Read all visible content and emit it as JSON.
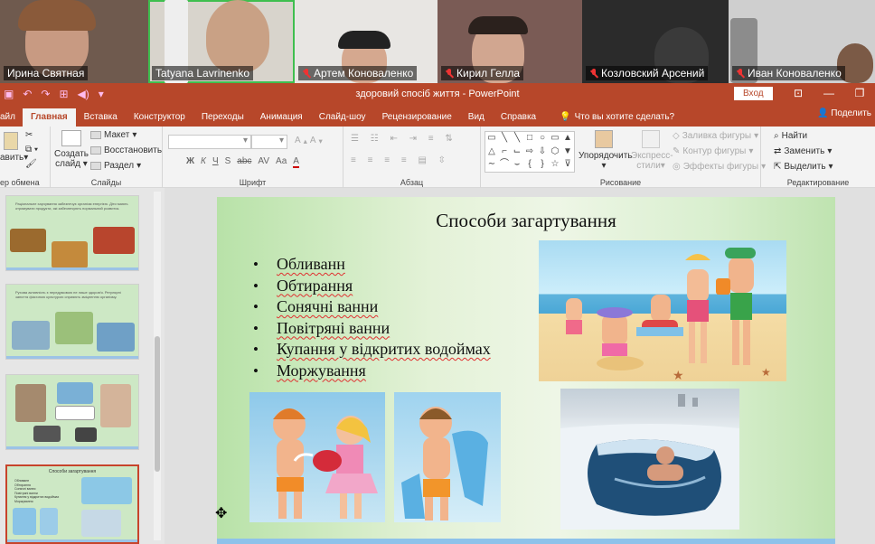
{
  "video": {
    "participants": [
      {
        "name": "Ирина Святная",
        "muted": false
      },
      {
        "name": "Tatyana Lavrinenko",
        "muted": false,
        "active": true
      },
      {
        "name": "Артем Коноваленко",
        "muted": true
      },
      {
        "name": "Кирил Гелла",
        "muted": true
      },
      {
        "name": "Козловский Арсений",
        "muted": true
      },
      {
        "name": "Иван Коноваленко",
        "muted": true
      }
    ]
  },
  "titlebar": {
    "title": "здоровий спосіб життя - PowerPoint",
    "login": "Вход"
  },
  "tabs": [
    "айл",
    "Главная",
    "Вставка",
    "Конструктор",
    "Переходы",
    "Анимация",
    "Слайд-шоу",
    "Рецензирование",
    "Вид",
    "Справка"
  ],
  "tellme": "Что вы хотите сделать?",
  "share": "Поделить",
  "ribbon": {
    "clipboard": {
      "paste": "авить",
      "label": "ер обмена"
    },
    "slides": {
      "new_slide_1": "Создать",
      "new_slide_2": "слайд",
      "layout": "Макет",
      "reset": "Восстановить",
      "section": "Раздел",
      "label": "Слайды"
    },
    "font": {
      "label": "Шрифт",
      "bold": "Ж",
      "italic": "К",
      "underline": "Ч",
      "strike": "S",
      "abc": "abc",
      "spacing": "AV",
      "case": "Aa",
      "color": "A"
    },
    "paragraph": {
      "label": "Абзац"
    },
    "drawing": {
      "arrange": "Упорядочить",
      "styles_1": "Экспресс-",
      "styles_2": "стили",
      "fill": "Заливка фигуры",
      "outline": "Контур фигуры",
      "effects": "Эффекты фигуры",
      "label": "Рисование"
    },
    "editing": {
      "find": "Найти",
      "replace": "Заменить",
      "select": "Выделить",
      "label": "Редактирование"
    }
  },
  "thumbnails": [
    {
      "text": "Раціональне харчування забезпечує організм енергією. Діти мають отримувати продукти, які забезпечують нормальний розвиток."
    },
    {
      "text": "Рухова активність є передумовою не лише здоров'я. Регулярні заняття фізичною культурою сприяють зміцненню організму."
    },
    {
      "text": ""
    },
    {
      "text": "Способи загартування",
      "selected": true
    }
  ],
  "slide": {
    "title": "Способи загартування",
    "bullets": [
      "Обливанн",
      "Обтирання",
      "Сонячні ванни",
      "Повітряні ванни",
      "Купання у відкритих водоймах",
      "Моржування"
    ]
  },
  "colors": {
    "ppt_red": "#b7472a",
    "active_tile": "#3fbf4f",
    "muted_icon": "#e33333"
  }
}
